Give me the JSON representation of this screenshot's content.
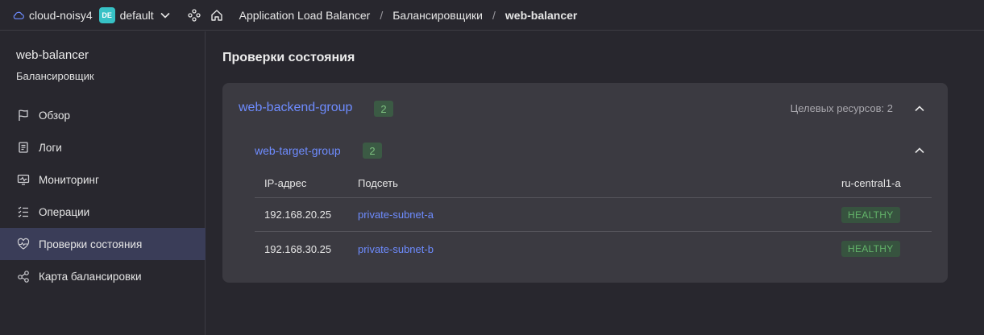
{
  "header": {
    "cloud_name": "cloud-noisy4",
    "folder_badge": "DE",
    "folder_name": "default",
    "breadcrumbs": [
      "Application Load Balancer",
      "Балансировщики",
      "web-balancer"
    ],
    "separator": "/",
    "accent_color": "#37c2c6"
  },
  "sidebar": {
    "title": "web-balancer",
    "subtitle": "Балансировщик",
    "items": [
      {
        "label": "Обзор",
        "icon": "flag-icon",
        "active": false
      },
      {
        "label": "Логи",
        "icon": "log-icon",
        "active": false
      },
      {
        "label": "Мониторинг",
        "icon": "monitor-icon",
        "active": false
      },
      {
        "label": "Операции",
        "icon": "operations-icon",
        "active": false
      },
      {
        "label": "Проверки состояния",
        "icon": "heartbeat-icon",
        "active": true
      },
      {
        "label": "Карта балансировки",
        "icon": "share-map-icon",
        "active": false
      }
    ]
  },
  "main": {
    "title": "Проверки состояния",
    "backend_group": {
      "name": "web-backend-group",
      "count": "2",
      "targets_label": "Целевых ресурсов: 2",
      "target_group": {
        "name": "web-target-group",
        "count": "2",
        "columns": [
          "IP-адрес",
          "Подсеть",
          "ru-central1-a"
        ],
        "rows": [
          {
            "ip": "192.168.20.25",
            "subnet": "private-subnet-a",
            "status": "HEALTHY"
          },
          {
            "ip": "192.168.30.25",
            "subnet": "private-subnet-b",
            "status": "HEALTHY"
          }
        ]
      }
    },
    "link_color": "#6e8cff",
    "healthy_color": "#63b46a"
  }
}
